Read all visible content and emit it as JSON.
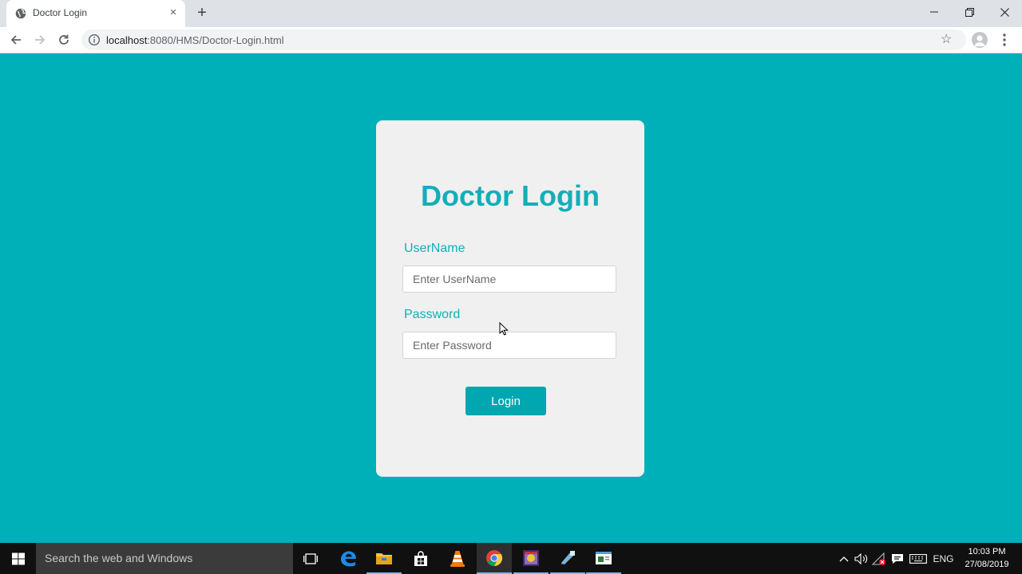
{
  "browser": {
    "tab_title": "Doctor Login",
    "tab_close": "×",
    "new_tab": "+",
    "url_host": "localhost",
    "url_path": ":8080/HMS/Doctor-Login.html",
    "star": "☆"
  },
  "login": {
    "title": "Doctor Login",
    "username_label": "UserName",
    "username_placeholder": "Enter UserName",
    "password_label": "Password",
    "password_placeholder": "Enter Password",
    "login_button": "Login"
  },
  "taskbar": {
    "search_placeholder": "Search the web and Windows",
    "language": "ENG",
    "time": "10:03 PM",
    "date": "27/08/2019"
  },
  "colors": {
    "page_background": "#00b0b9",
    "card_background": "#f0f0f0",
    "accent": "#14aeb8",
    "button": "#00a6b0"
  }
}
